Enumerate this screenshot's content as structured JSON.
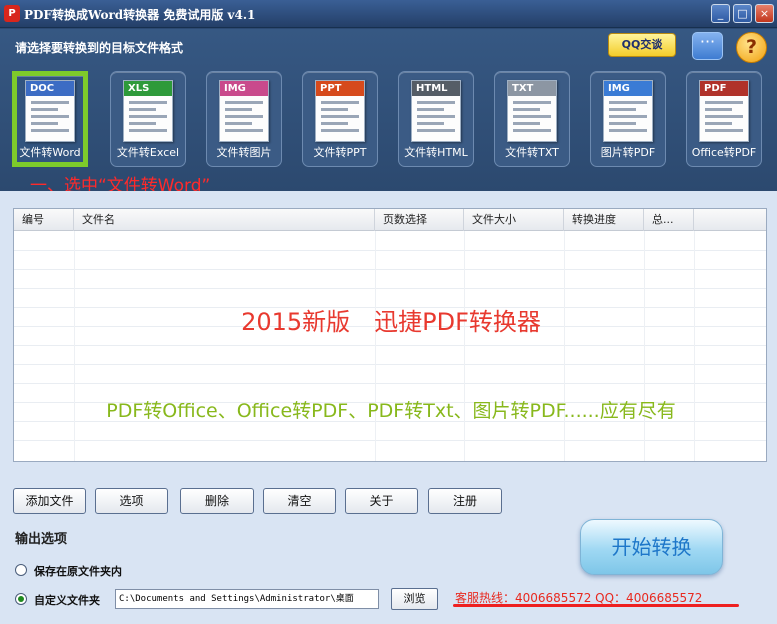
{
  "window": {
    "title": "PDF转换成Word转换器 免费试用版 v4.1",
    "logo_glyph": "P",
    "controls": {
      "minimize": "_",
      "maximize": "□",
      "close": "×"
    }
  },
  "header": {
    "choose_label": "请选择要转换到的目标文件格式",
    "qq_chat_label": "QQ交谈",
    "chat_glyph": "···",
    "help_glyph": "?"
  },
  "tools": [
    {
      "tag": "DOC",
      "label": "文件转Word",
      "color": "#3c6cc4",
      "selected": true
    },
    {
      "tag": "XLS",
      "label": "文件转Excel",
      "color": "#2e9a3a",
      "selected": false
    },
    {
      "tag": "IMG",
      "label": "文件转图片",
      "color": "#c94a8c",
      "selected": false
    },
    {
      "tag": "PPT",
      "label": "文件转PPT",
      "color": "#d64a1c",
      "selected": false
    },
    {
      "tag": "HTML",
      "label": "文件转HTML",
      "color": "#555d66",
      "selected": false
    },
    {
      "tag": "TXT",
      "label": "文件转TXT",
      "color": "#8c96a3",
      "selected": false
    },
    {
      "tag": "IMG",
      "label": "图片转PDF",
      "color": "#3a7bd5",
      "selected": false
    },
    {
      "tag": "PDF",
      "label": "Office转PDF",
      "color": "#b0322a",
      "selected": false
    }
  ],
  "step_hint": "一、选中“文件转Word”",
  "table": {
    "columns": [
      "编号",
      "文件名",
      "页数选择",
      "文件大小",
      "转换进度",
      "总..."
    ]
  },
  "promo": {
    "line1": "2015新版　迅捷PDF转换器",
    "line2": "PDF转Office、Office转PDF、PDF转Txt、图片转PDF......应有尽有"
  },
  "buttons": {
    "add_file": "添加文件",
    "options": "选项",
    "delete": "删除",
    "clear": "清空",
    "about": "关于",
    "register": "注册"
  },
  "output": {
    "title": "输出选项",
    "keep_original": "保存在原文件夹内",
    "custom_folder": "自定义文件夹",
    "path_value": "C:\\Documents and Settings\\Administrator\\桌面",
    "browse": "浏览",
    "selected": "custom_folder"
  },
  "start_button": "开始转换",
  "hotline": "客服热线：4006685572 QQ：4006685572"
}
